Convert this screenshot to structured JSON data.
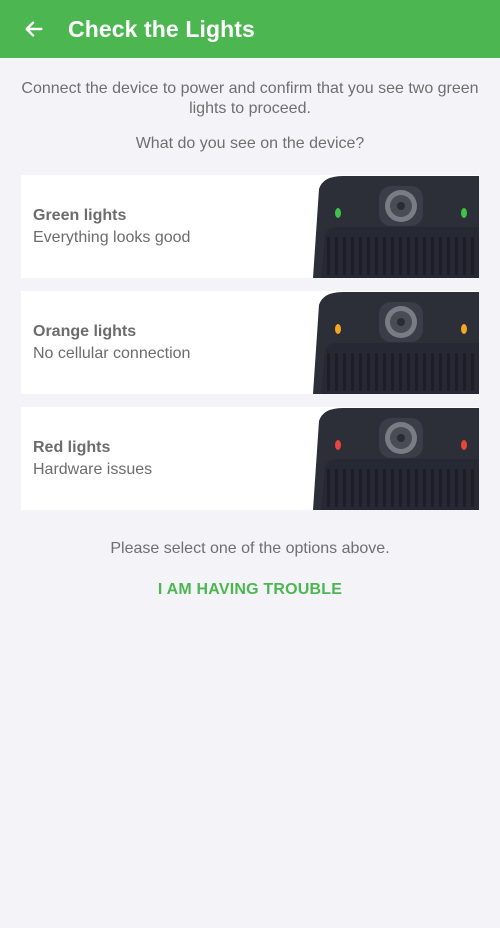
{
  "header": {
    "title": "Check the Lights",
    "back_icon": "arrow-left-icon",
    "background": "#4cb751"
  },
  "instructions": "Connect the device to power and confirm that you see two green lights to proceed.",
  "question": "What do you see on the device?",
  "options": [
    {
      "title": "Green lights",
      "subtitle": "Everything looks good",
      "light_color": "#3fc24a"
    },
    {
      "title": "Orange lights",
      "subtitle": "No cellular connection",
      "light_color": "#f5a623"
    },
    {
      "title": "Red lights",
      "subtitle": "Hardware issues",
      "light_color": "#e8453c"
    }
  ],
  "footer_message": "Please select one of the options above.",
  "trouble_button": "I AM HAVING TROUBLE",
  "accent_color": "#4cb751"
}
